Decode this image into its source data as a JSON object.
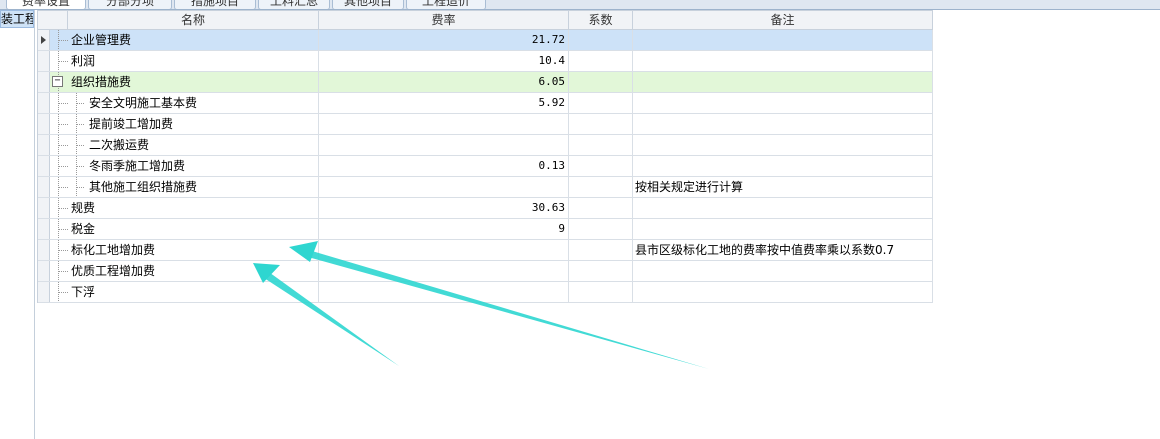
{
  "tabs": [
    {
      "label": "费率设置",
      "active": true
    },
    {
      "label": "分部分项",
      "active": false
    },
    {
      "label": "措施项目",
      "active": false
    },
    {
      "label": "工料汇总",
      "active": false
    },
    {
      "label": "其他项目",
      "active": false
    },
    {
      "label": "工程造价",
      "active": false
    }
  ],
  "left_panel": {
    "selected_item": "装工程"
  },
  "grid": {
    "headers": {
      "name": "名称",
      "rate": "费率",
      "coefficient": "系数",
      "note": "备注"
    },
    "rows": [
      {
        "name": "企业管理费",
        "rate": "21.72",
        "coefficient": "",
        "note": "",
        "level": 0,
        "state": "selected"
      },
      {
        "name": "利润",
        "rate": "10.4",
        "coefficient": "",
        "note": "",
        "level": 0,
        "state": ""
      },
      {
        "name": "组织措施费",
        "rate": "6.05",
        "coefficient": "",
        "note": "",
        "level": 0,
        "state": "group"
      },
      {
        "name": "安全文明施工基本费",
        "rate": "5.92",
        "coefficient": "",
        "note": "",
        "level": 1,
        "state": ""
      },
      {
        "name": "提前竣工增加费",
        "rate": "",
        "coefficient": "",
        "note": "",
        "level": 1,
        "state": ""
      },
      {
        "name": "二次搬运费",
        "rate": "",
        "coefficient": "",
        "note": "",
        "level": 1,
        "state": ""
      },
      {
        "name": "冬雨季施工增加费",
        "rate": "0.13",
        "coefficient": "",
        "note": "",
        "level": 1,
        "state": ""
      },
      {
        "name": "其他施工组织措施费",
        "rate": "",
        "coefficient": "",
        "note": "按相关规定进行计算",
        "level": 1,
        "state": ""
      },
      {
        "name": "规费",
        "rate": "30.63",
        "coefficient": "",
        "note": "",
        "level": 0,
        "state": ""
      },
      {
        "name": "税金",
        "rate": "9",
        "coefficient": "",
        "note": "",
        "level": 0,
        "state": ""
      },
      {
        "name": "标化工地增加费",
        "rate": "",
        "coefficient": "",
        "note": "县市区级标化工地的费率按中值费率乘以系数0.7",
        "level": 0,
        "state": ""
      },
      {
        "name": "优质工程增加费",
        "rate": "",
        "coefficient": "",
        "note": "",
        "level": 0,
        "state": ""
      },
      {
        "name": "下浮",
        "rate": "",
        "coefficient": "",
        "note": "",
        "level": 0,
        "state": ""
      }
    ]
  },
  "colors": {
    "selected_row": "#cde2f8",
    "group_row": "#e2f7d8",
    "annotation_arrow": "#2ed6d0"
  },
  "icons": {
    "row_indicator": "triangle-right-icon",
    "collapse_toggle": "minus-box-icon"
  }
}
